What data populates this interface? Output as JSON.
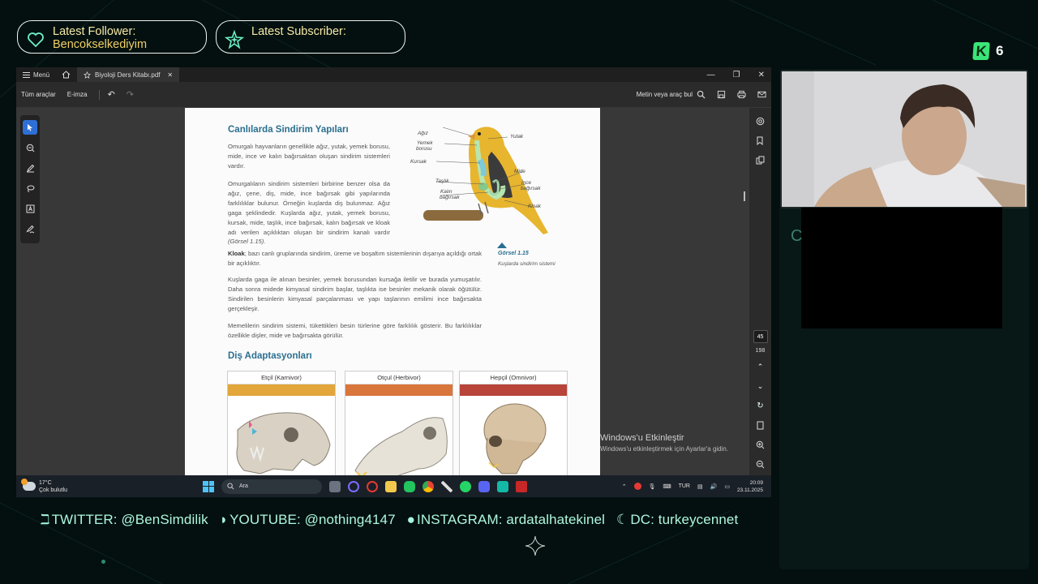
{
  "overlay": {
    "latest_follower_title": "Latest Follower:",
    "latest_follower_name": "Bencokselkediyim",
    "latest_subscriber_title": "Latest Subscriber:",
    "latest_subscriber_name": "",
    "kick_count": "6",
    "side_glyph": "C",
    "socials": {
      "twitter": "TWITTER: @BenSimdilik",
      "youtube": "YOUTUBE: @nothing4147",
      "instagram": "INSTAGRAM: ardatalhatekinel",
      "discord": "DC: turkeycennet"
    }
  },
  "acrobat": {
    "menu_label": "Menü",
    "tab_title": "Biyoloji Ders Kitabı.pdf",
    "toolbar": {
      "all_tools": "Tüm araçlar",
      "esign": "E-imza",
      "find_placeholder": "Metin veya araç bul"
    },
    "page_current": "45",
    "page_total": "198",
    "watermark_title": "Windows'u Etkinleştir",
    "watermark_sub": "Windows'u etkinleştirmek için Ayarlar'a gidin."
  },
  "document": {
    "heading1": "Canlılarda Sindirim Yapıları",
    "para1": "Omurgalı hayvanların genellikle ağız, yutak, yemek borusu, mide, ince ve kalın bağırsaktan oluşan sindirim sistemleri vardır.",
    "para2a": "Omurgalıların sindirim sistemleri birbirine benzer olsa da ağız, çene, diş, mide, ince bağırsak gibi yapılarında farklılıklar bulunur. Örneğin kuşlarda diş bulunmaz. Ağız gaga şeklindedir. Kuşlarda ağız, yutak, yemek borusu, kursak, mide, taşlık, ince bağırsak, kalın bağırsak ve kloak adı verilen açıklıktan oluşan bir sindirim kanalı vardır",
    "para2_ref": "(Görsel 1.15).",
    "para2_bold": "Kloak",
    "para2b": "; bazı canlı gruplarında sindirim, üreme ve boşaltım sistemlerinin dışarıya açıldığı ortak bir açıklıktır.",
    "para3": "Kuşlarda gaga ile alınan besinler, yemek borusundan kursağa iletilir ve burada yumuşatılır. Daha sonra midede kimyasal sindirim başlar, taşlıkta ise besinler mekanik olarak öğütülür. Sindirilen besinlerin kimyasal parçalanması ve yapı taşlarının emilimi ince bağırsakta gerçekleşir.",
    "para4": "Memelilerin sindirim sistemi, tükettikleri besin türlerine göre farklılık gösterir. Bu farklılıklar özellikle dişler, mide ve bağırsakta görülür.",
    "heading2": "Diş Adaptasyonları",
    "figure_caption": "Görsel 1.15",
    "figure_subcaption": "Kuşlarda sindirim sistemi",
    "bird_labels": {
      "agiz": "Ağız",
      "yemek": "Yemek",
      "borusu": "borusu",
      "kursak": "Kursak",
      "taslik": "Taşlık",
      "kalin": "Kalın",
      "kalin2": "bağırsak",
      "yutak": "Yutak",
      "mide": "Mide",
      "ince": "İnce",
      "ince2": "bağırsak",
      "kloak": "Kloak"
    },
    "cards": [
      {
        "title": "Etçil (Karnivor)",
        "color": "#e3a63a"
      },
      {
        "title": "Otçul (Herbivor)",
        "color": "#d8763c"
      },
      {
        "title": "Hepçil (Omnivor)",
        "color": "#b8443a"
      }
    ]
  },
  "taskbar": {
    "temp": "17°C",
    "weather": "Çok bulutlu",
    "search_placeholder": "Ara",
    "lang": "TUR",
    "time": "20:09",
    "date": "23.11.2025"
  }
}
